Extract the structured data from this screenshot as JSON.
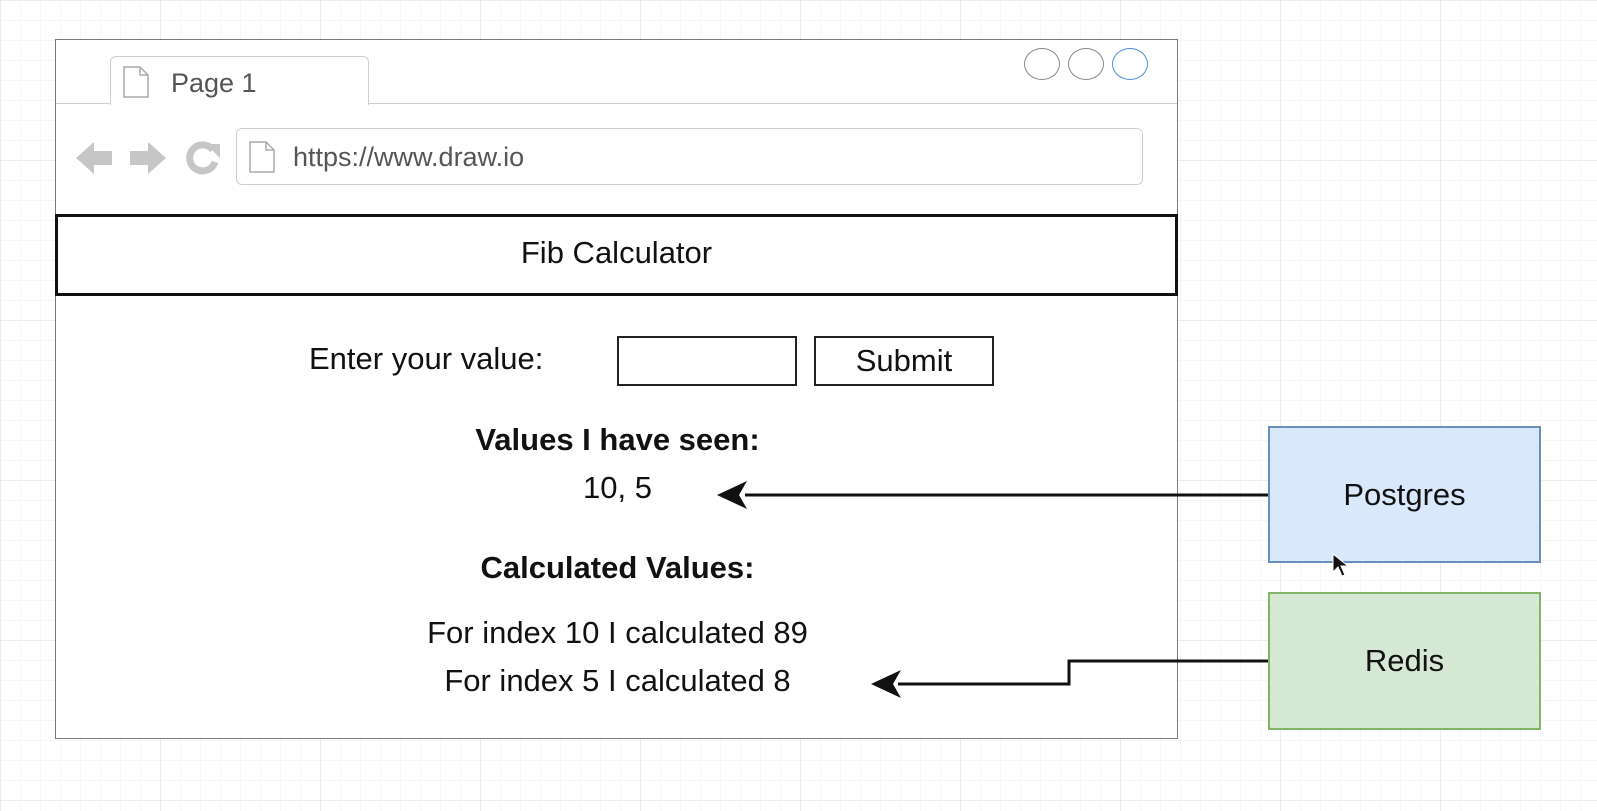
{
  "browser": {
    "tab": {
      "label": "Page 1"
    },
    "url": "https://www.draw.io"
  },
  "app": {
    "title": "Fib Calculator",
    "form": {
      "label": "Enter your value:",
      "input_value": "",
      "submit_label": "Submit"
    },
    "seen": {
      "heading": "Values I have seen:",
      "values": "10, 5"
    },
    "calculated": {
      "heading": "Calculated Values:",
      "lines": [
        "For index 10 I calculated 89",
        "For index 5 I calculated 8"
      ]
    }
  },
  "databases": {
    "postgres": {
      "label": "Postgres",
      "fill": "#dae8fc",
      "stroke": "#6c8ebf"
    },
    "redis": {
      "label": "Redis",
      "fill": "#d5e8d4",
      "stroke": "#82b366"
    }
  },
  "icons": [
    "doc-icon",
    "back-arrow-icon",
    "forward-arrow-icon",
    "refresh-icon",
    "window-button-icon",
    "mouse-cursor-icon"
  ]
}
